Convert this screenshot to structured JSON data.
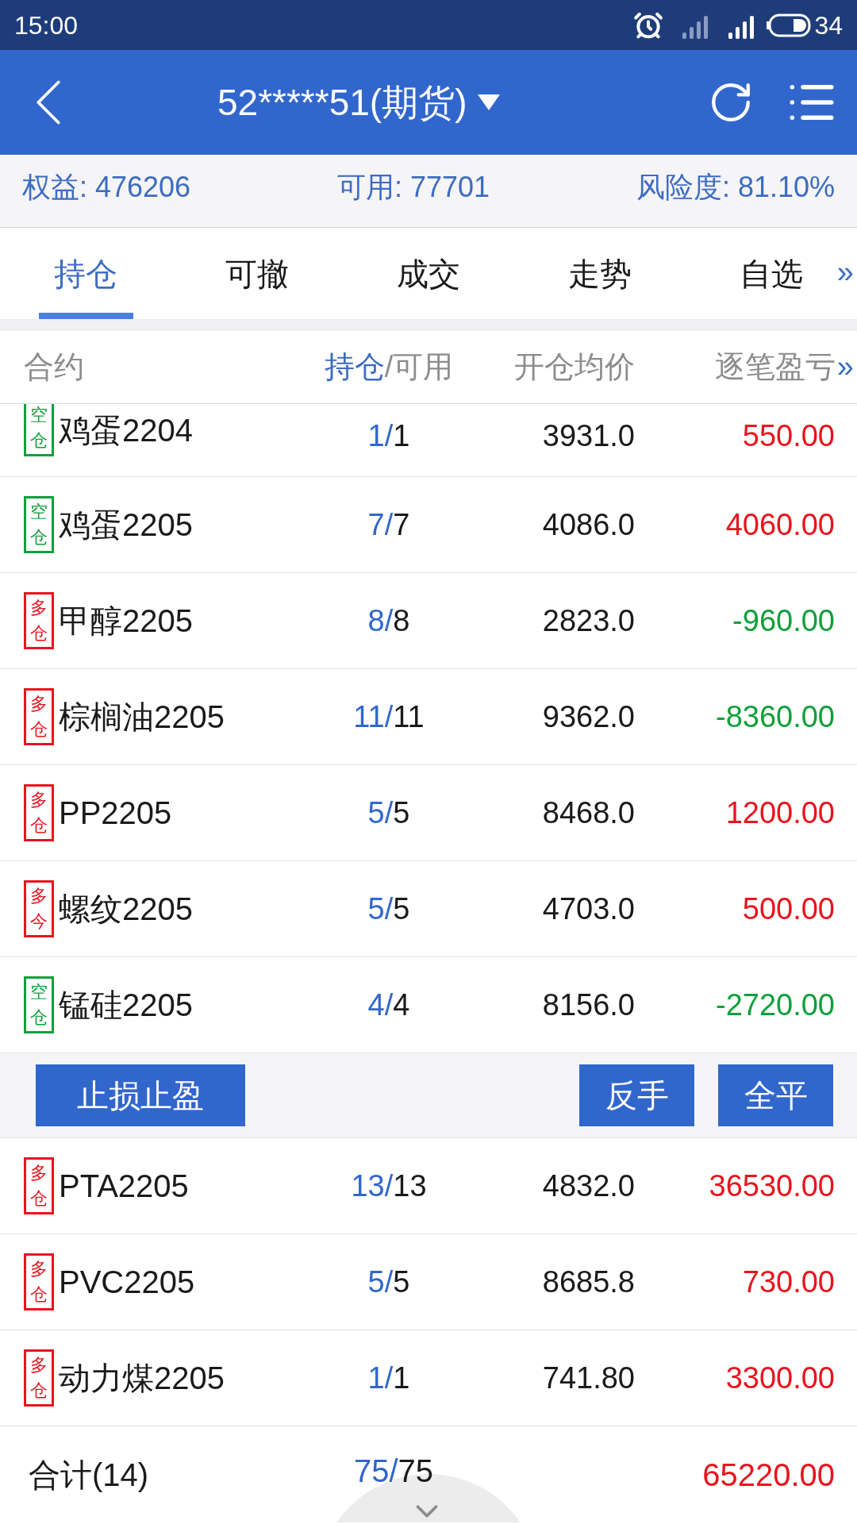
{
  "status_bar": {
    "time": "15:00",
    "battery": "34"
  },
  "header": {
    "title": "52*****51(期货)"
  },
  "summary": [
    {
      "label": "权益: ",
      "value": "476206"
    },
    {
      "label": "可用: ",
      "value": "77701"
    },
    {
      "label": "风险度: ",
      "value": "81.10%"
    }
  ],
  "tabs": [
    {
      "label": "持仓",
      "selected": true
    },
    {
      "label": "可撤",
      "selected": false
    },
    {
      "label": "成交",
      "selected": false
    },
    {
      "label": "走势",
      "selected": false
    },
    {
      "label": "自选",
      "selected": false
    }
  ],
  "tabs_more": "»",
  "columns": {
    "contract": "合约",
    "held": "持仓",
    "available": "/可用",
    "open_price": "开仓均价",
    "pnl": "逐笔盈亏",
    "more": "»"
  },
  "rows_top": [
    {
      "badge": {
        "label": "空仓",
        "color": "#10a03c"
      },
      "name": "鸡蛋2204",
      "held": "1/",
      "available": "1",
      "price": "3931.0",
      "pnl": {
        "value": "550.00",
        "color": "#e8141e"
      }
    },
    {
      "badge": {
        "label": "空仓",
        "color": "#10a03c"
      },
      "name": "鸡蛋2205",
      "held": "7/",
      "available": "7",
      "price": "4086.0",
      "pnl": {
        "value": "4060.00",
        "color": "#e8141e"
      }
    },
    {
      "badge": {
        "label": "多仓",
        "color": "#e8141e"
      },
      "name": "甲醇2205",
      "held": "8/",
      "available": "8",
      "price": "2823.0",
      "pnl": {
        "value": "-960.00",
        "color": "#10a03c"
      }
    },
    {
      "badge": {
        "label": "多仓",
        "color": "#e8141e"
      },
      "name": "棕榈油2205",
      "held": "11/",
      "available": "11",
      "price": "9362.0",
      "pnl": {
        "value": "-8360.00",
        "color": "#10a03c"
      }
    },
    {
      "badge": {
        "label": "多仓",
        "color": "#e8141e"
      },
      "name": "PP2205",
      "held": "5/",
      "available": "5",
      "price": "8468.0",
      "pnl": {
        "value": "1200.00",
        "color": "#e8141e"
      }
    },
    {
      "badge": {
        "label": "多今",
        "color": "#e8141e"
      },
      "name": "螺纹2205",
      "held": "5/",
      "available": "5",
      "price": "4703.0",
      "pnl": {
        "value": "500.00",
        "color": "#e8141e"
      }
    },
    {
      "badge": {
        "label": "空仓",
        "color": "#10a03c"
      },
      "name": "锰硅2205",
      "held": "4/",
      "available": "4",
      "price": "8156.0",
      "pnl": {
        "value": "-2720.00",
        "color": "#10a03c"
      }
    }
  ],
  "actions": {
    "left": [
      "止损止盈"
    ],
    "right": [
      "反手",
      "全平"
    ]
  },
  "rows_bottom": [
    {
      "badge": {
        "label": "多仓",
        "color": "#e8141e"
      },
      "name": "PTA2205",
      "held": "13/",
      "available": "13",
      "price": "4832.0",
      "pnl": {
        "value": "36530.00",
        "color": "#e8141e"
      }
    },
    {
      "badge": {
        "label": "多仓",
        "color": "#e8141e"
      },
      "name": "PVC2205",
      "held": "5/",
      "available": "5",
      "price": "8685.8",
      "pnl": {
        "value": "730.00",
        "color": "#e8141e"
      }
    },
    {
      "badge": {
        "label": "多仓",
        "color": "#e8141e"
      },
      "name": "动力煤2205",
      "held": "1/",
      "available": "1",
      "price": "741.80",
      "pnl": {
        "value": "3300.00",
        "color": "#e8141e"
      }
    }
  ],
  "total": {
    "label": "合计(14)",
    "held": "75/",
    "available": "75",
    "pnl": {
      "value": "65220.00",
      "color": "#e8141e"
    }
  }
}
